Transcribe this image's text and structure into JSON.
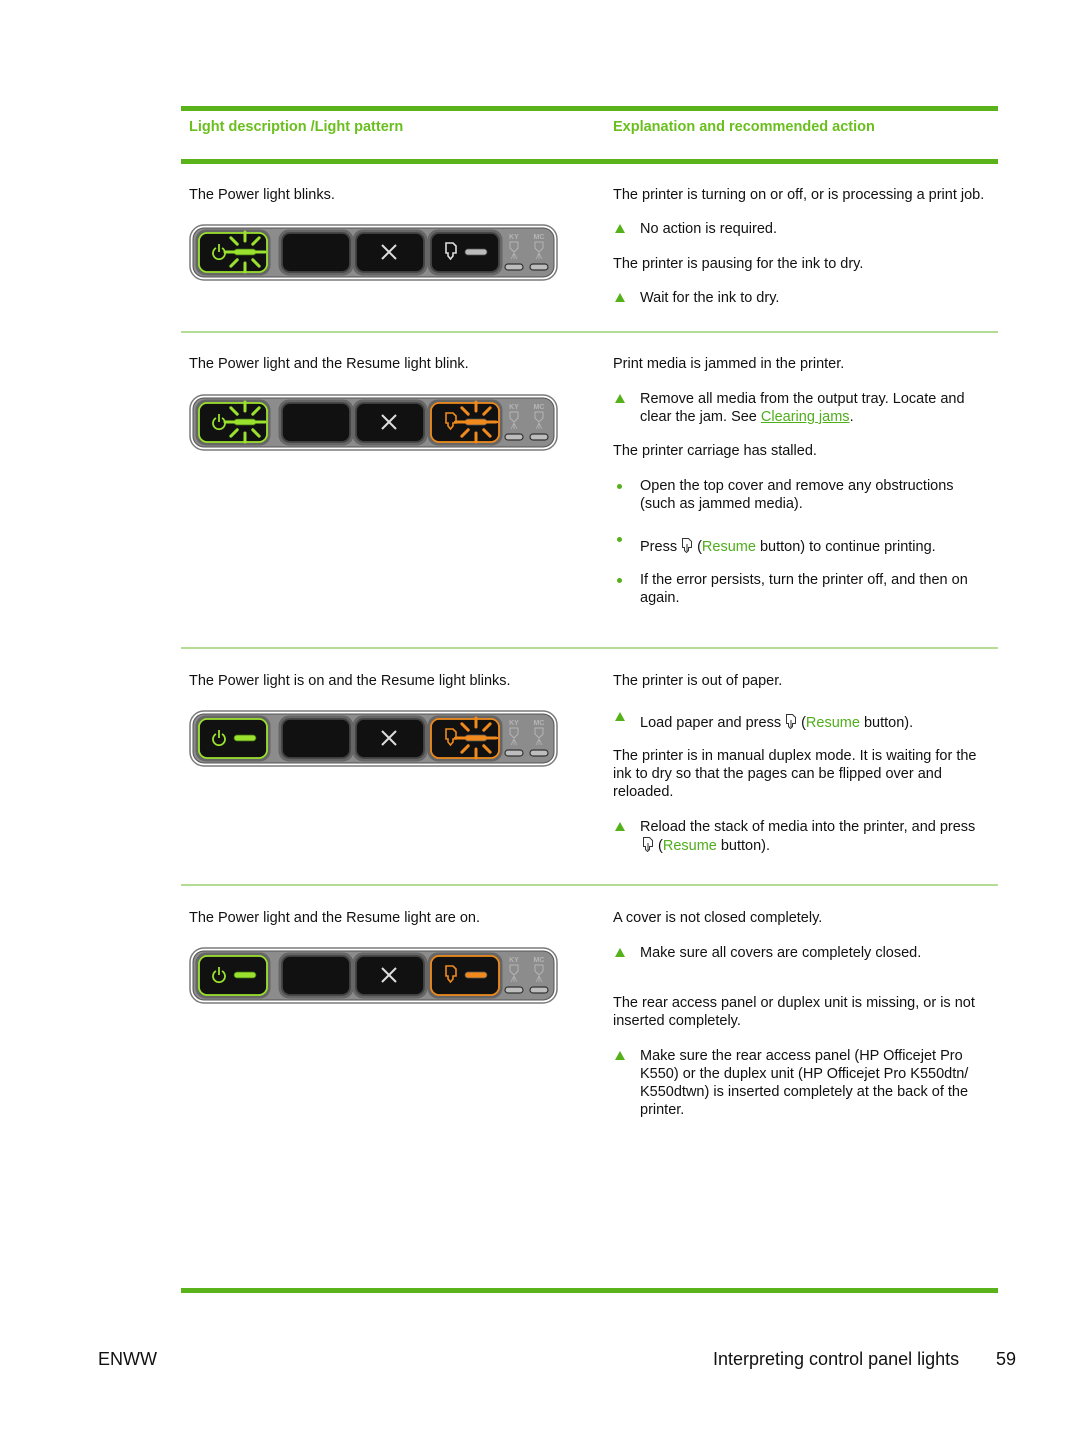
{
  "table": {
    "headers": {
      "left": "Light description /Light pattern",
      "right": "Explanation and recommended action"
    },
    "rows": [
      {
        "description": "The Power light blinks.",
        "pattern": {
          "power": "blinking",
          "resume": "off"
        },
        "explanation": [
          {
            "type": "para",
            "text": "The printer is turning on or off, or is processing a print job."
          },
          {
            "type": "triangle",
            "text": "No action is required."
          },
          {
            "type": "para",
            "text": "The printer is pausing for the ink to dry."
          },
          {
            "type": "triangle",
            "text": "Wait for the ink to dry."
          }
        ]
      },
      {
        "description": "The Power light and the Resume light blink.",
        "pattern": {
          "power": "blinking",
          "resume": "blinking"
        },
        "explanation": [
          {
            "type": "para",
            "text": "Print media is jammed in the printer."
          },
          {
            "type": "triangle",
            "text_before": "Remove all media from the output tray. Locate and clear the jam. See ",
            "link": "Clearing jams",
            "text_after": "."
          },
          {
            "type": "para",
            "text": "The printer carriage has stalled."
          },
          {
            "type": "dot",
            "text": "Open the top cover and remove any obstructions (such as jammed media)."
          },
          {
            "type": "dot",
            "text_before": "Press",
            "link": "Resume",
            "text_after": " button) to continue printing."
          },
          {
            "type": "dot",
            "text": "If the error persists, turn the printer off, and then on again."
          }
        ]
      },
      {
        "description": "The Power light is on and the Resume light blinks.",
        "pattern": {
          "power": "on",
          "resume": "blinking"
        },
        "explanation": [
          {
            "type": "para",
            "text": "The printer is out of paper."
          },
          {
            "type": "triangle",
            "text_before": "Load paper and press",
            "link": "Resume",
            "text_after": " button)."
          },
          {
            "type": "para",
            "text": "The printer is in manual duplex mode. It is waiting for the ink to dry so that the pages can be flipped over and reloaded."
          },
          {
            "type": "triangle",
            "text_before": "Reload the stack of media into the printer, and press",
            "link": "Resume",
            "text_after": " button)."
          }
        ]
      },
      {
        "description": "The Power light and the Resume light are on.",
        "pattern": {
          "power": "on",
          "resume": "on"
        },
        "explanation": [
          {
            "type": "para",
            "text": "A cover is not closed completely."
          },
          {
            "type": "triangle",
            "text": "Make sure all covers are completely closed."
          },
          {
            "type": "para",
            "text": "The rear access panel or duplex unit is missing, or is not inserted completely."
          },
          {
            "type": "triangle",
            "text": "Make sure the rear access panel (HP Officejet Pro K550) or the duplex unit (HP Officejet Pro K550dtn/ K550dtwn) is inserted completely at the back of the printer."
          }
        ]
      }
    ]
  },
  "panel_labels": {
    "ink_left": "KY",
    "ink_right": "MC"
  },
  "common": {
    "open_paren": "("
  },
  "colors": {
    "accent_green": "#5bb31b",
    "power_light": "#9be22e",
    "resume_light": "#f08a1c"
  },
  "footer": {
    "left": "ENWW",
    "title": "Interpreting control panel lights",
    "page": "59"
  }
}
